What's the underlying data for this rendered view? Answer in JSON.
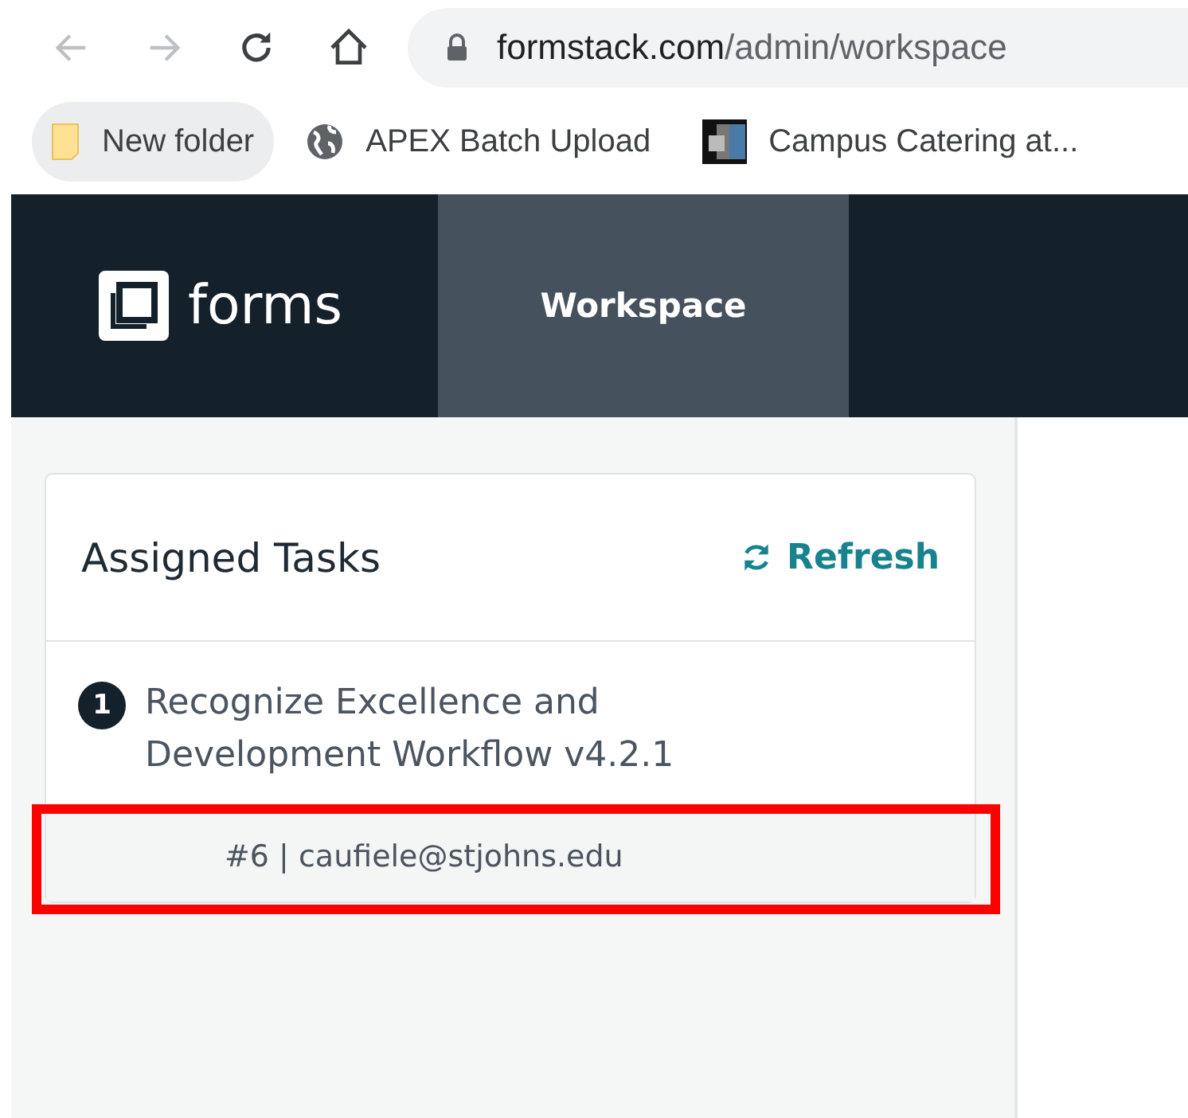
{
  "browser": {
    "buttons": [
      {
        "kind": "back",
        "disabled": true
      },
      {
        "kind": "forward",
        "disabled": true
      },
      {
        "kind": "reload",
        "disabled": false
      },
      {
        "kind": "home",
        "disabled": false
      }
    ],
    "address": {
      "host": "formstack.com",
      "path": "/admin/workspace"
    },
    "bookmarks": [
      {
        "kind": "folder",
        "label": "New folder"
      },
      {
        "kind": "globe",
        "label": "APEX Batch Upload"
      },
      {
        "kind": "tile",
        "label": "Campus Catering at..."
      }
    ]
  },
  "app_bar": {
    "logo": "forms",
    "tabs": [
      {
        "label": "Workspace",
        "selected": true
      }
    ]
  },
  "tasks_panel": {
    "title": "Assigned Tasks",
    "refresh": "Refresh",
    "tasks": [
      {
        "number": "1",
        "name": "Recognize Excellence and Development Workflow v4.2.1",
        "detail": "#6 | caufiele@stjohns.edu",
        "highlighted": true
      }
    ]
  }
}
